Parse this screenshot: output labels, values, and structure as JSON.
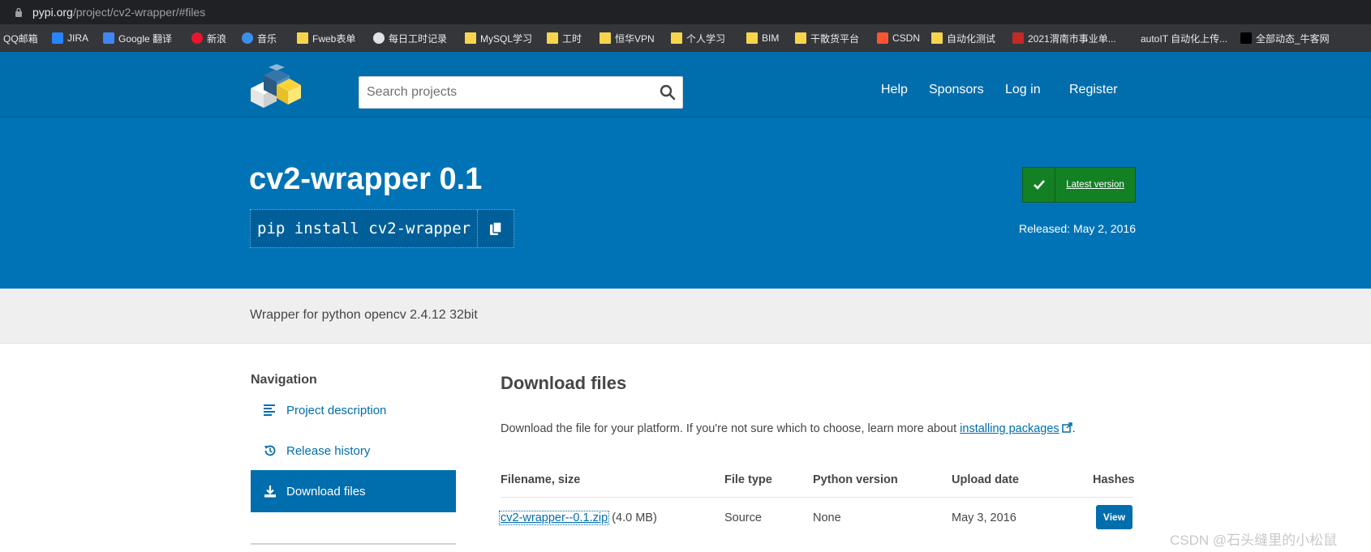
{
  "browser": {
    "url_host": "pypi.org",
    "url_path": "/project/cv2-wrapper/#files",
    "bookmarks": [
      {
        "label": "QQ邮箱",
        "icon": "qq-mail-icon"
      },
      {
        "label": "JIRA",
        "icon": "jira-icon"
      },
      {
        "label": "Google 翻译",
        "icon": "google-translate-icon"
      },
      {
        "label": "新浪",
        "icon": "weibo-icon"
      },
      {
        "label": "音乐",
        "icon": "music-icon"
      },
      {
        "label": "Fweb表单",
        "icon": "folder-icon"
      },
      {
        "label": "每日工时记录",
        "icon": "tracker-icon"
      },
      {
        "label": "MySQL学习",
        "icon": "folder-icon"
      },
      {
        "label": "工时",
        "icon": "folder-icon"
      },
      {
        "label": "恒华VPN",
        "icon": "folder-icon"
      },
      {
        "label": "个人学习",
        "icon": "folder-icon"
      },
      {
        "label": "BIM",
        "icon": "folder-icon"
      },
      {
        "label": "干散货平台",
        "icon": "folder-icon"
      },
      {
        "label": "CSDN",
        "icon": "csdn-icon"
      },
      {
        "label": "自动化测试",
        "icon": "folder-icon"
      },
      {
        "label": "2021渭南市事业单...",
        "icon": "gov-icon"
      },
      {
        "label": "autoIT 自动化上传...",
        "icon": "blank-icon"
      },
      {
        "label": "全部动态_牛客网",
        "icon": "nowcoder-icon"
      }
    ]
  },
  "header": {
    "search_placeholder": "Search projects",
    "nav": [
      "Help",
      "Sponsors",
      "Log in",
      "Register"
    ]
  },
  "project": {
    "title": "cv2-wrapper 0.1",
    "pip_command": "pip install cv2-wrapper",
    "latest_label": "Latest version",
    "released": "Released: May 2, 2016",
    "summary": "Wrapper for python opencv 2.4.12 32bit"
  },
  "sidebar": {
    "heading": "Navigation",
    "items": [
      {
        "label": "Project description",
        "icon": "align-left-icon",
        "active": false
      },
      {
        "label": "Release history",
        "icon": "history-icon",
        "active": false
      },
      {
        "label": "Download files",
        "icon": "download-icon",
        "active": true
      }
    ]
  },
  "main": {
    "heading": "Download files",
    "intro_text": "Download the file for your platform. If you're not sure which to choose, learn more about ",
    "intro_link": "installing packages",
    "intro_end": ".",
    "columns": [
      "Filename, size",
      "File type",
      "Python version",
      "Upload date",
      "Hashes"
    ],
    "rows": [
      {
        "filename": "cv2-wrapper--0.1.zip",
        "size": "(4.0 MB)",
        "file_type": "Source",
        "python_version": "None",
        "upload_date": "May 3, 2016",
        "hashes_button": "View"
      }
    ]
  },
  "watermark": "CSDN @石头缝里的小松鼠",
  "colors": {
    "header_blue": "#006dad",
    "banner_blue": "#0073b7",
    "latest_green": "#148024",
    "link_blue": "#006dad",
    "text_gray": "#464646"
  }
}
